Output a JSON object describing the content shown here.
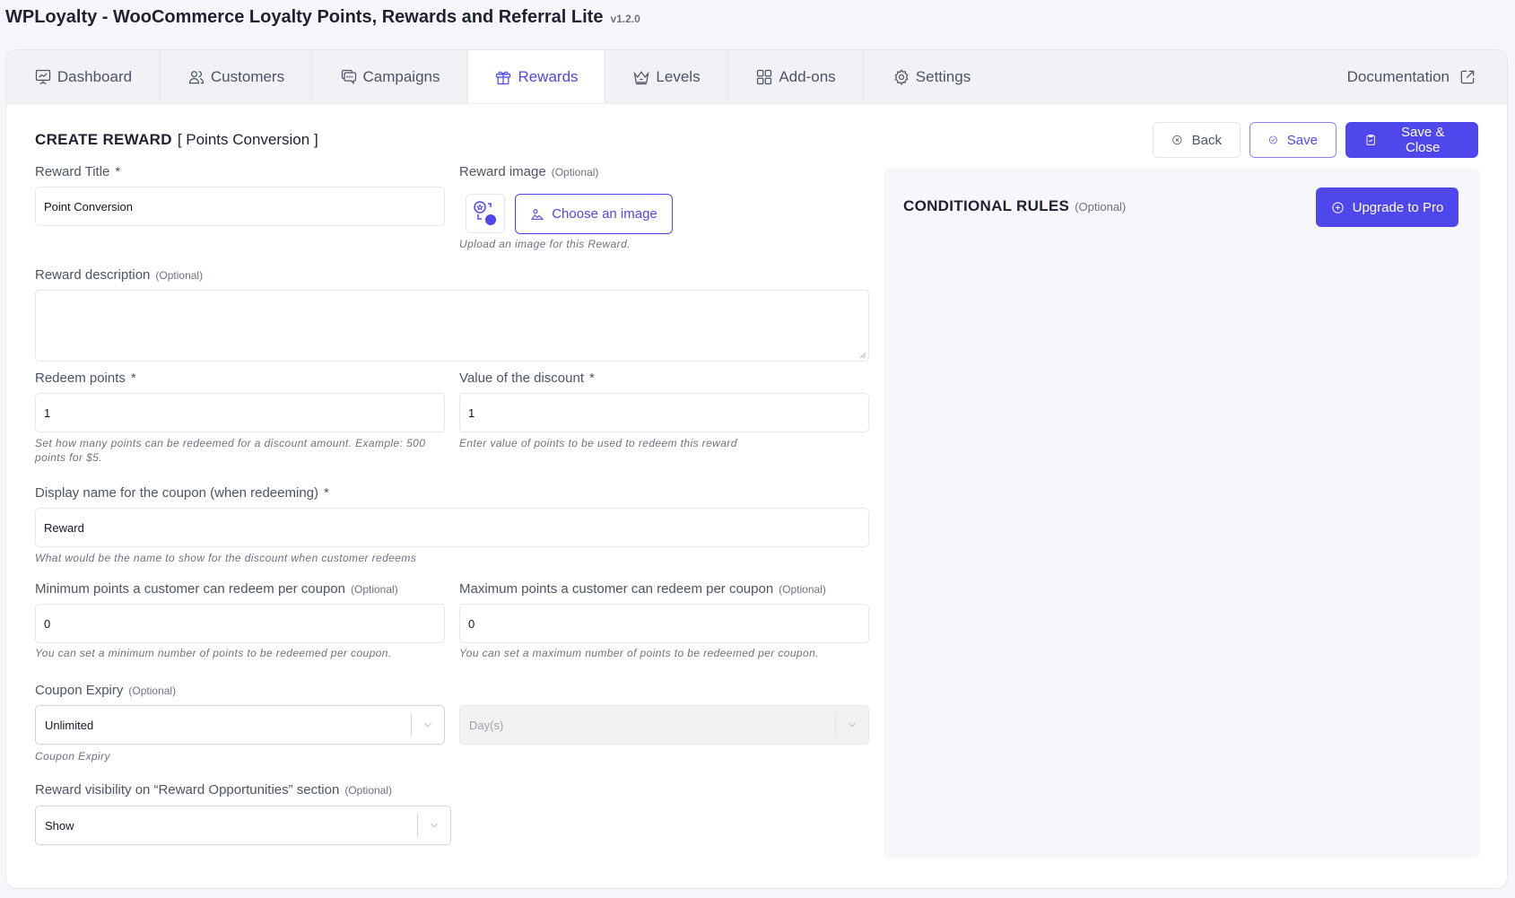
{
  "app": {
    "title": "WPLoyalty - WooCommerce Loyalty Points, Rewards and Referral Lite",
    "version": "v1.2.0"
  },
  "tabs": [
    {
      "label": "Dashboard",
      "icon": "presentation-chart-icon",
      "active": false
    },
    {
      "label": "Customers",
      "icon": "users-icon",
      "active": false
    },
    {
      "label": "Campaigns",
      "icon": "chat-bubbles-icon",
      "active": false
    },
    {
      "label": "Rewards",
      "icon": "gift-icon",
      "active": true
    },
    {
      "label": "Levels",
      "icon": "crown-icon",
      "active": false
    },
    {
      "label": "Add-ons",
      "icon": "grid-icon",
      "active": false
    },
    {
      "label": "Settings",
      "icon": "gear-icon",
      "active": false
    }
  ],
  "documentation": {
    "label": "Documentation",
    "icon": "external-link-icon"
  },
  "page": {
    "heading": "CREATE REWARD",
    "subheading": "[ Points Conversion ]"
  },
  "actions": {
    "back": "Back",
    "save": "Save",
    "save_close": "Save & Close"
  },
  "colors": {
    "primary": "#4f47eb",
    "background": "#f7f7fb"
  },
  "form": {
    "optional": "(Optional)",
    "required_mark": "*",
    "reward_title": {
      "label": "Reward Title",
      "value": "Point Conversion"
    },
    "reward_image": {
      "label": "Reward image",
      "button": "Choose an image",
      "hint": "Upload an image for this Reward."
    },
    "reward_description": {
      "label": "Reward description",
      "value": ""
    },
    "redeem_points": {
      "label": "Redeem points",
      "value": "1",
      "hint": "Set how many points can be redeemed for a discount amount. Example: 500 points for $5."
    },
    "discount_value": {
      "label": "Value of the discount",
      "value": "1",
      "hint": "Enter value of points to be used to redeem this reward"
    },
    "coupon_display_name": {
      "label": "Display name for the coupon (when redeeming)",
      "value": "Reward",
      "hint": "What would be the name to show for the discount when customer redeems"
    },
    "min_points": {
      "label": "Minimum points a customer can redeem per coupon",
      "value": "0",
      "hint": "You can set a minimum number of points to be redeemed per coupon."
    },
    "max_points": {
      "label": "Maximum points a customer can redeem per coupon",
      "value": "0",
      "hint": "You can set a maximum number of points to be redeemed per coupon."
    },
    "coupon_expiry": {
      "label": "Coupon Expiry",
      "selected": "Unlimited",
      "unit_selected": "Day(s)",
      "hint": "Coupon Expiry"
    },
    "visibility": {
      "label": "Reward visibility on “Reward Opportunities” section",
      "selected": "Show"
    }
  },
  "conditional_rules": {
    "title": "CONDITIONAL RULES",
    "optional": "(Optional)",
    "upgrade_button": "Upgrade to Pro"
  }
}
